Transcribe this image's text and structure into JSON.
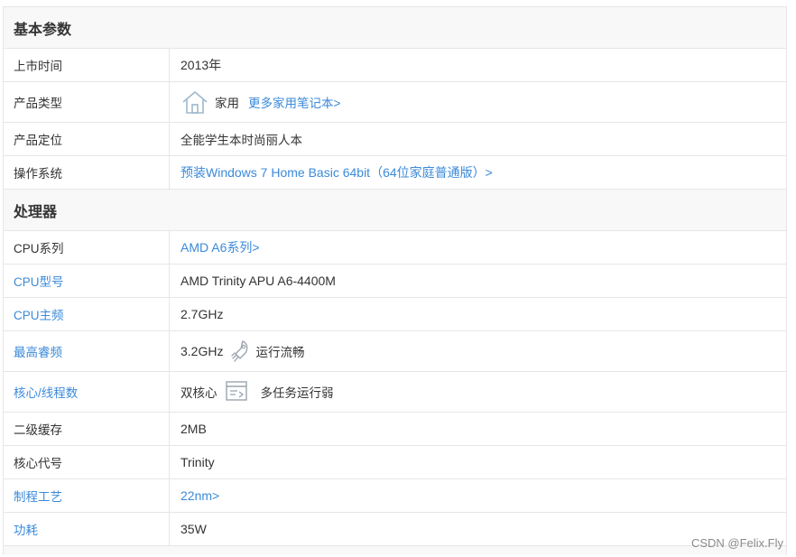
{
  "sections": [
    {
      "title": "基本参数",
      "rows": [
        {
          "label": "上市时间",
          "value": "2013年"
        },
        {
          "label": "产品类型",
          "value": "家用",
          "link": "更多家用笔记本>",
          "icon": "house-icon"
        },
        {
          "label": "产品定位",
          "value": "全能学生本时尚丽人本"
        },
        {
          "label": "操作系统",
          "link": "预装Windows 7 Home Basic 64bit（64位家庭普通版）>"
        }
      ]
    },
    {
      "title": "处理器",
      "rows": [
        {
          "label": "CPU系列",
          "link": "AMD A6系列>"
        },
        {
          "label": "CPU型号",
          "value": "AMD Trinity APU A6-4400M",
          "label_link": true
        },
        {
          "label": "CPU主频",
          "value": "2.7GHz",
          "label_link": true
        },
        {
          "label": "最高睿频",
          "value": "3.2GHz",
          "note": "运行流畅",
          "icon": "rocket-icon",
          "label_link": true
        },
        {
          "label": "核心/线程数",
          "value": "双核心",
          "note": "多任务运行弱",
          "icon": "multitask-icon",
          "label_link": true
        },
        {
          "label": "二级缓存",
          "value": "2MB"
        },
        {
          "label": "核心代号",
          "value": "Trinity"
        },
        {
          "label": "制程工艺",
          "link": "22nm>",
          "label_link": true
        },
        {
          "label": "功耗",
          "value": "35W",
          "label_link": true
        }
      ]
    }
  ],
  "watermark": "CSDN @Felix.Fly",
  "colors": {
    "link": "#3b8ad9",
    "border": "#e6e6e6",
    "header_bg": "#f8f8f8"
  }
}
